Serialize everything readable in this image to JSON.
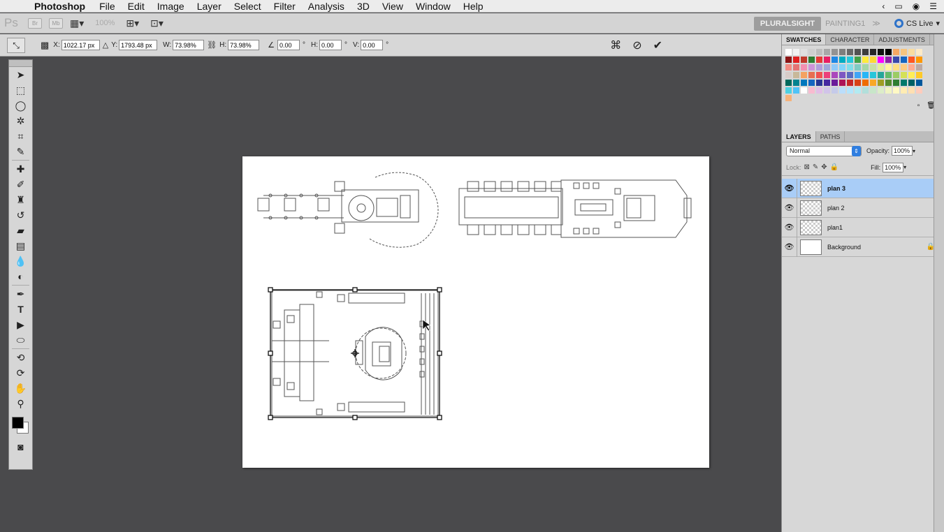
{
  "menubar": {
    "app_name": "Photoshop",
    "items": [
      "File",
      "Edit",
      "Image",
      "Layer",
      "Select",
      "Filter",
      "Analysis",
      "3D",
      "View",
      "Window",
      "Help"
    ]
  },
  "appbar": {
    "logo": "Ps",
    "bridge": "Br",
    "minibridge": "Mb",
    "zoom": "100%"
  },
  "workspace": {
    "active": "PLURALSIGHT",
    "other": "PAINTING1",
    "more": "≫",
    "cslive": "CS Live"
  },
  "options": {
    "x_label": "X:",
    "x_value": "1022.17 px",
    "y_label": "Y:",
    "y_value": "1793.48 px",
    "w_label": "W:",
    "w_value": "73.98%",
    "h_label": "H:",
    "h_value": "73.98%",
    "rot_value": "0.00",
    "hskew_label": "H:",
    "hskew_value": "0.00",
    "vskew_label": "V:",
    "vskew_value": "0.00",
    "deg": "°"
  },
  "swatches_panel": {
    "tabs": [
      "SWATCHES",
      "CHARACTER",
      "ADJUSTMENTS"
    ],
    "colors": [
      "#ffffff",
      "#f2f2f2",
      "#e0e0e0",
      "#cfcfcf",
      "#bdbdbd",
      "#a8a8a8",
      "#939393",
      "#7e7e7e",
      "#686868",
      "#525252",
      "#3d3d3d",
      "#272727",
      "#121212",
      "#000000",
      "#f5a863",
      "#f7c57e",
      "#f9dca0",
      "#fbe9c6",
      "#8c1515",
      "#e02020",
      "#c0392b",
      "#2e7d32",
      "#e53935",
      "#e91e63",
      "#1e88e5",
      "#00acc1",
      "#26c6da",
      "#43a047",
      "#ffeb3b",
      "#fdd835",
      "#ff00ff",
      "#8e24aa",
      "#3949ab",
      "#1565c0",
      "#ff5722",
      "#ff9800",
      "#f28b82",
      "#e57373",
      "#f48fb1",
      "#ce93d8",
      "#b39ddb",
      "#9fa8da",
      "#90caf9",
      "#81d4fa",
      "#80deea",
      "#80cbc4",
      "#a5d6a7",
      "#c5e1a5",
      "#e6ee9c",
      "#fff59d",
      "#ffe082",
      "#ffcc80",
      "#ffab91",
      "#bcaaa4",
      "#d7ccc8",
      "#c8b89a",
      "#f4a261",
      "#e76f51",
      "#ef5350",
      "#ec407a",
      "#ab47bc",
      "#7e57c2",
      "#5c6bc0",
      "#42a5f5",
      "#29b6f6",
      "#26c6da",
      "#26a69a",
      "#66bb6a",
      "#9ccc65",
      "#d4e157",
      "#ffee58",
      "#ffca28",
      "#00695c",
      "#00838f",
      "#0277bd",
      "#1565c0",
      "#283593",
      "#4527a0",
      "#6a1b9a",
      "#ad1457",
      "#c62828",
      "#d84315",
      "#ef6c00",
      "#f9a825",
      "#9e9d24",
      "#558b2f",
      "#2e7d32",
      "#00796b",
      "#006064",
      "#01579b",
      "#4dd0e1",
      "#4fc3f7",
      "#ffffff",
      "#f8bbd0",
      "#e1bee7",
      "#d1c4e9",
      "#c5cae9",
      "#bbdefb",
      "#b3e5fc",
      "#b2ebf2",
      "#b2dfdb",
      "#c8e6c9",
      "#dcedc8",
      "#f0f4c3",
      "#fff9c4",
      "#ffecb3",
      "#ffe0b2",
      "#ffccbc",
      "#f7b27a"
    ]
  },
  "layers_panel": {
    "tabs": [
      "LAYERS",
      "PATHS"
    ],
    "blend_mode": "Normal",
    "opacity_label": "Opacity:",
    "opacity": "100%",
    "lock_label": "Lock:",
    "fill_label": "Fill:",
    "fill": "100%",
    "layers": [
      {
        "name": "plan 3",
        "selected": true
      },
      {
        "name": "plan 2",
        "selected": false
      },
      {
        "name": "plan1",
        "selected": false
      },
      {
        "name": "Background",
        "selected": false
      }
    ]
  }
}
